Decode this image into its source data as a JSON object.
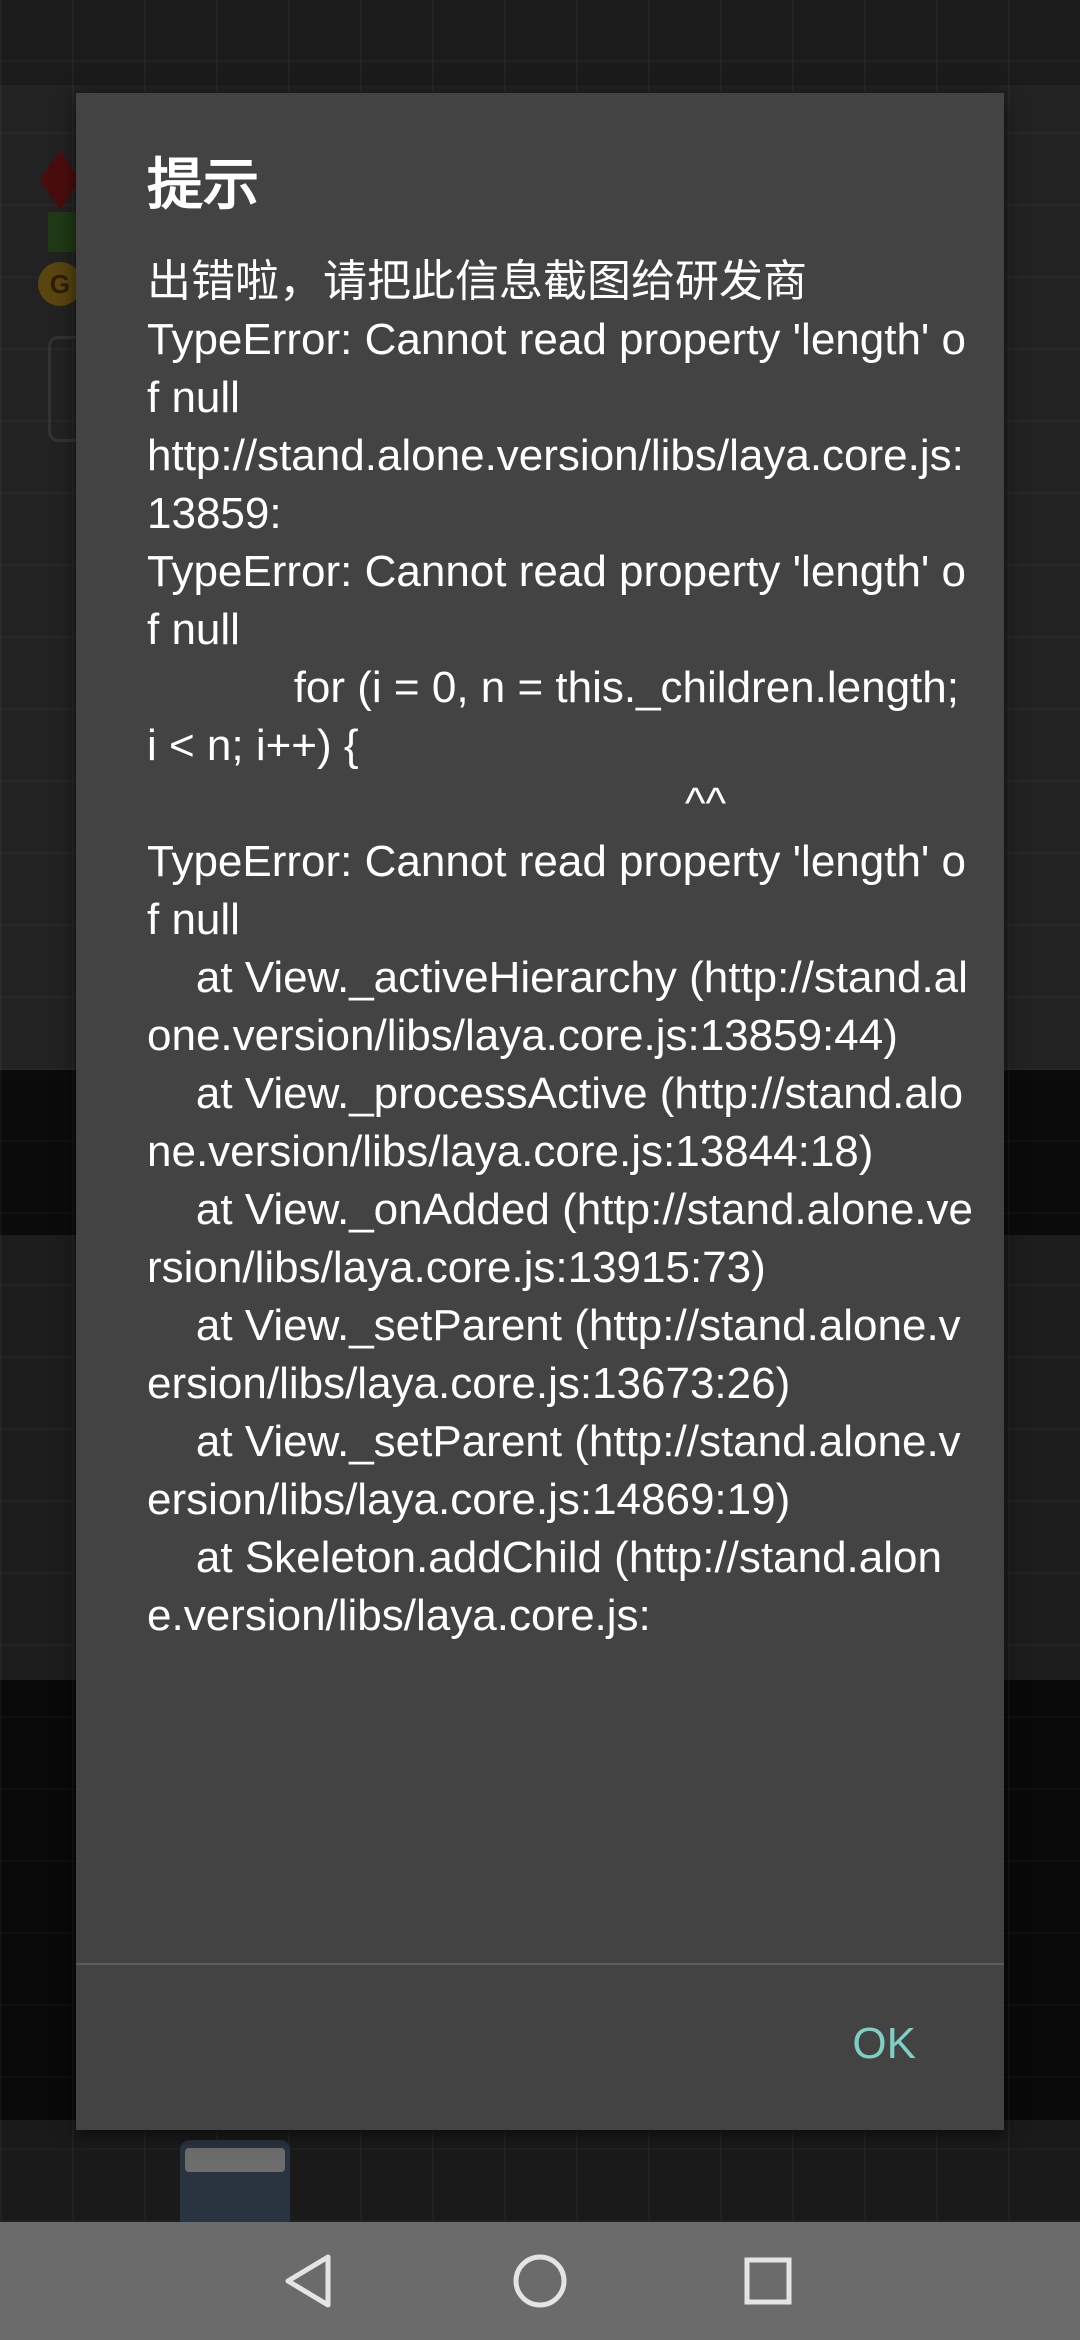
{
  "dialog": {
    "title": "提示",
    "message": "出错啦，请把此信息截图给研发商\nTypeError: Cannot read property 'length' of null\nhttp://stand.alone.version/libs/laya.core.js:13859:\nTypeError: Cannot read property 'length' of null\n            for (i = 0, n = this._children.length; i < n; i++) {\n                                            ^^\nTypeError: Cannot read property 'length' of null\n    at View._activeHierarchy (http://stand.alone.version/libs/laya.core.js:13859:44)\n    at View._processActive (http://stand.alone.version/libs/laya.core.js:13844:18)\n    at View._onAdded (http://stand.alone.version/libs/laya.core.js:13915:73)\n    at View._setParent (http://stand.alone.version/libs/laya.core.js:13673:26)\n    at View._setParent (http://stand.alone.version/libs/laya.core.js:14869:19)\n    at Skeleton.addChild (http://stand.alone.version/libs/laya.core.js:",
    "ok_label": "OK",
    "ok_color": "#7fd0c4",
    "background_color": "#434343"
  },
  "background": {
    "coin_letter": "G"
  },
  "navbar": {
    "back_icon": "triangle-back-icon",
    "home_icon": "circle-home-icon",
    "recents_icon": "square-recents-icon",
    "background_color": "#6b6b6b"
  }
}
